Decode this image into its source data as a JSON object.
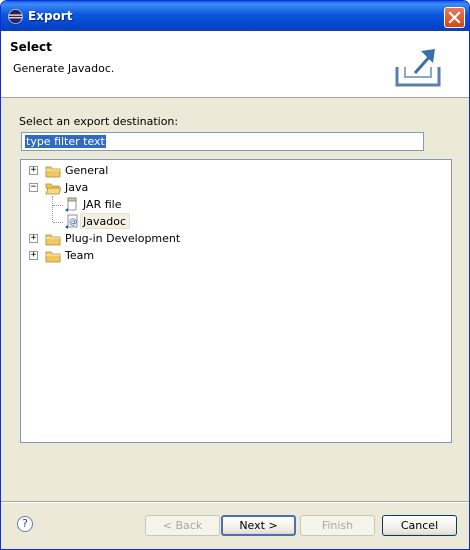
{
  "window": {
    "title": "Export"
  },
  "header": {
    "title": "Select",
    "description": "Generate Javadoc."
  },
  "body": {
    "destination_label": "Select an export destination:",
    "filter": {
      "value": "type filter text"
    }
  },
  "tree": {
    "general": {
      "label": "General",
      "expander": "+"
    },
    "java": {
      "label": "Java",
      "expander": "−"
    },
    "jar_file": {
      "label": "JAR file"
    },
    "javadoc": {
      "label": "Javadoc"
    },
    "plugin_dev": {
      "label": "Plug-in Development",
      "expander": "+"
    },
    "team": {
      "label": "Team",
      "expander": "+"
    }
  },
  "footer": {
    "help_symbol": "?",
    "back_label": "< Back",
    "next_label": "Next >",
    "finish_label": "Finish",
    "cancel_label": "Cancel"
  },
  "colors": {
    "titlebar": "#0446cf",
    "selection": "#316ac5",
    "dialog_bg": "#ece9d8",
    "folder": "#f0c860"
  }
}
